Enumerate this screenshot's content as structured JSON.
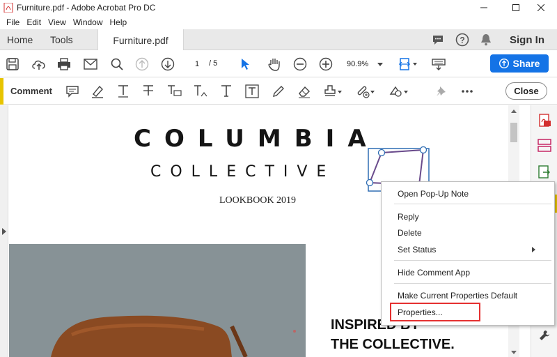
{
  "window": {
    "title": "Furniture.pdf - Adobe Acrobat Pro DC"
  },
  "menubar": {
    "items": [
      "File",
      "Edit",
      "View",
      "Window",
      "Help"
    ]
  },
  "tabs": {
    "home": "Home",
    "tools": "Tools",
    "document": "Furniture.pdf",
    "sign_in": "Sign In"
  },
  "toolbar": {
    "page_current": "1",
    "page_total": "/ 5",
    "zoom": "90.9%",
    "share_label": "Share"
  },
  "commentbar": {
    "label": "Comment",
    "close_label": "Close"
  },
  "document": {
    "brand_line1": "COLUMBIA",
    "brand_line2": "COLLECTIVE",
    "subtitle": "LOOKBOOK 2019",
    "heading_line1": "INSPIRED BY",
    "heading_line2": "THE COLLECTIVE."
  },
  "context_menu": {
    "open_popup_note": "Open Pop-Up Note",
    "reply": "Reply",
    "delete": "Delete",
    "set_status": "Set Status",
    "hide_comment_app": "Hide Comment App",
    "make_default": "Make Current Properties Default",
    "properties": "Properties..."
  },
  "colors": {
    "accent_blue": "#1473e6",
    "comment_accent": "#e7c400",
    "highlight_red": "#e53030",
    "annotation_stroke": "#6a4b8c"
  }
}
